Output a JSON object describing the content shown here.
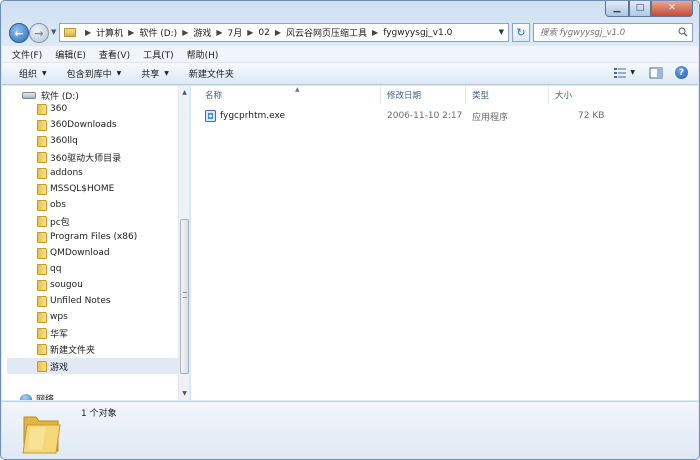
{
  "address": {
    "crumbs": [
      "计算机",
      "软件 (D:)",
      "游戏",
      "7月",
      "02",
      "风云谷网页压缩工具",
      "fygwyysgj_v1.0"
    ]
  },
  "search": {
    "placeholder": "搜索 fygwyysgj_v1.0"
  },
  "menubar": [
    "文件(F)",
    "编辑(E)",
    "查看(V)",
    "工具(T)",
    "帮助(H)"
  ],
  "commandbar": {
    "organize": "组织",
    "include_library": "包含到库中",
    "share": "共享",
    "new_folder": "新建文件夹"
  },
  "navpane": {
    "root": "软件 (D:)",
    "items": [
      "360",
      "360Downloads",
      "360llq",
      "360驱动大师目录",
      "addons",
      "MSSQL$HOME",
      "obs",
      "pc包",
      "Program Files (x86)",
      "QMDownload",
      "qq",
      "sougou",
      "Unfiled Notes",
      "wps",
      "华军",
      "新建文件夹",
      "游戏"
    ],
    "selected": "游戏",
    "network": "网络"
  },
  "columns": {
    "name": "名称",
    "modified": "修改日期",
    "type": "类型",
    "size": "大小"
  },
  "files": [
    {
      "name": "fygcprhtm.exe",
      "modified": "2006-11-10 2:17",
      "type": "应用程序",
      "size": "72 KB"
    }
  ],
  "details": {
    "count": "1 个对象"
  },
  "colors": {
    "accent": "#2f6db6",
    "selection": "#e0e9f4",
    "folder": "#e9c14d"
  }
}
